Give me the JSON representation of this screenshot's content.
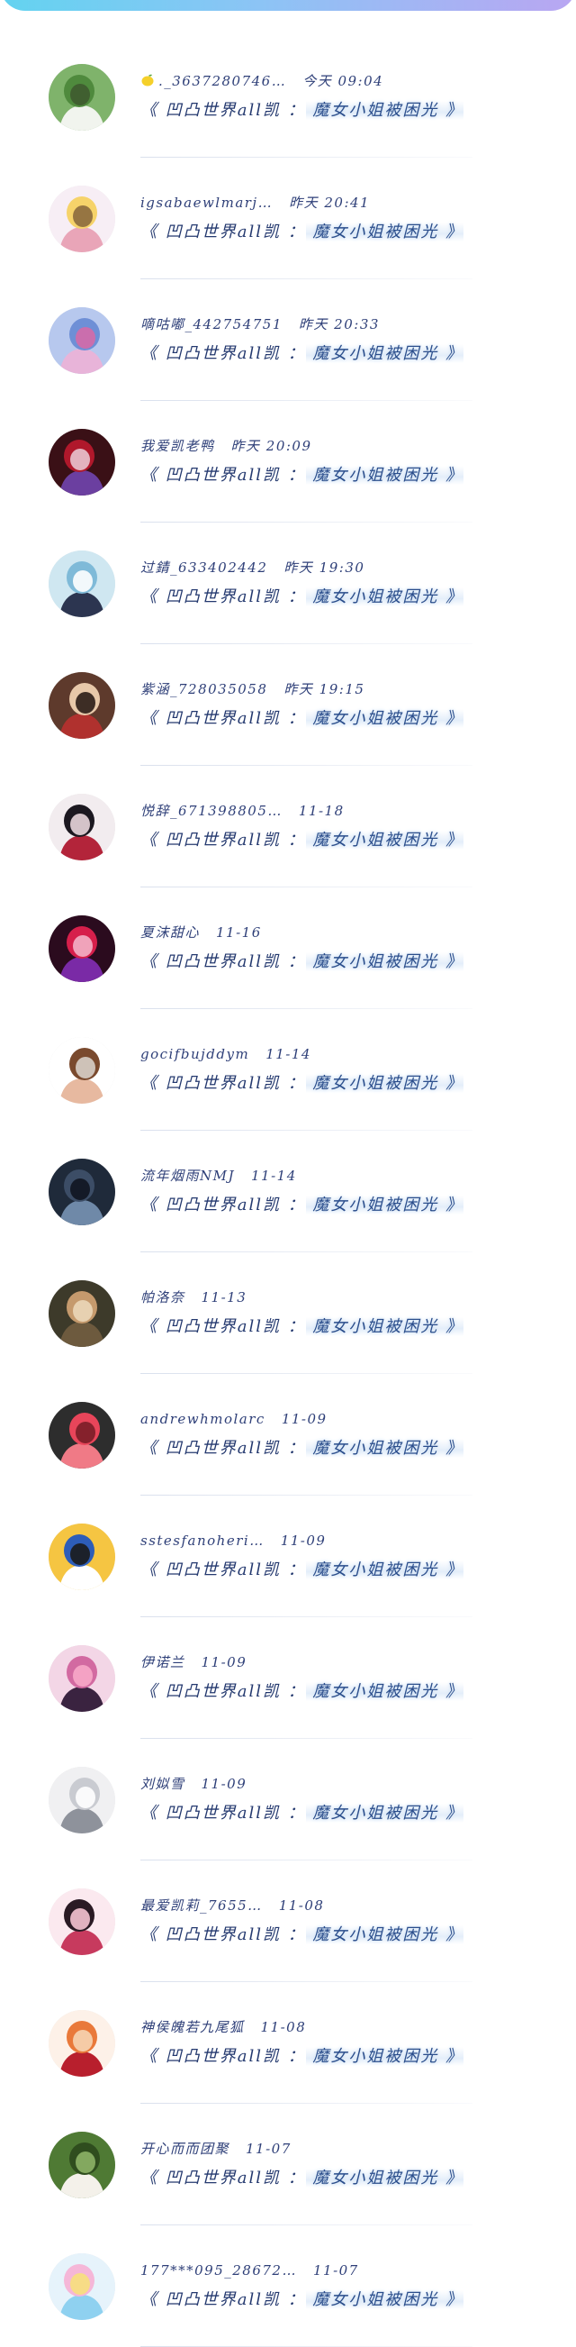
{
  "colors": {
    "accent_gradient_start": "#63d3f0",
    "accent_gradient_end": "#b9a6f2",
    "text": "#2e3f78",
    "highlight_glow": "#cfe0f3"
  },
  "comments": [
    {
      "user": "._3637280746…",
      "time": "今天 09:04",
      "prefix": "《 凹凸世界all凯 ：",
      "highlight": "魔女小姐被困光 》",
      "lemon": true,
      "avatar_palette": [
        "#7fb36b",
        "#4f8a3d",
        "#f1f4ee",
        "#3e5a2f"
      ]
    },
    {
      "user": "igsabaewlmarj…",
      "time": "昨天 20:41",
      "prefix": "《 凹凸世界all凯 ：",
      "highlight": "魔女小姐被困光 》",
      "avatar_palette": [
        "#f7eef5",
        "#f6d36a",
        "#e9a5b8",
        "#8c6a3e"
      ]
    },
    {
      "user": "嘀咕嘟_442754751",
      "time": "昨天 20:33",
      "prefix": "《 凹凸世界all凯 ：",
      "highlight": "魔女小姐被困光 》",
      "avatar_palette": [
        "#b7c8ee",
        "#6e8fd6",
        "#e8b4d9",
        "#d46aa8"
      ]
    },
    {
      "user": "我爱凯老鸭",
      "time": "昨天 20:09",
      "prefix": "《 凹凸世界all凯 ：",
      "highlight": "魔女小姐被困光 》",
      "avatar_palette": [
        "#3a1016",
        "#b0182b",
        "#6b3fa0",
        "#e9c4cf"
      ]
    },
    {
      "user": "过錆_633402442",
      "time": "昨天 19:30",
      "prefix": "《 凹凸世界all凯 ：",
      "highlight": "魔女小姐被困光 》",
      "avatar_palette": [
        "#cfe7f1",
        "#7fbad8",
        "#2c3550",
        "#ffffff"
      ]
    },
    {
      "user": "紫涵_728035058",
      "time": "昨天 19:15",
      "prefix": "《 凹凸世界all凯 ：",
      "highlight": "魔女小姐被困光 》",
      "avatar_palette": [
        "#5e3a2c",
        "#e7c8a9",
        "#b0312e",
        "#2a1c16"
      ]
    },
    {
      "user": "悦辞_671398805…",
      "time": "11-18",
      "prefix": "《 凹凸世界all凯 ：",
      "highlight": "魔女小姐被困光 》",
      "avatar_palette": [
        "#f2ecef",
        "#1c1820",
        "#b3243a",
        "#e9d6dc"
      ]
    },
    {
      "user": "夏沫甜心",
      "time": "11-16",
      "prefix": "《 凹凸世界all凯 ：",
      "highlight": "魔女小姐被困光 》",
      "avatar_palette": [
        "#2b0b1e",
        "#d61f4b",
        "#7a2aa6",
        "#f3b1c6"
      ]
    },
    {
      "user": "gocifbujddym",
      "time": "11-14",
      "prefix": "《 凹凸世界all凯 ：",
      "highlight": "魔女小姐被困光 》",
      "avatar_palette": [
        "#ffffff",
        "#7a4a2e",
        "#e7b9a0",
        "#d7cfc8"
      ]
    },
    {
      "user": "流年烟雨NMJ",
      "time": "11-14",
      "prefix": "《 凹凸世界all凯 ：",
      "highlight": "魔女小姐被困光 》",
      "avatar_palette": [
        "#1f2a3a",
        "#3c4d66",
        "#6f89a8",
        "#0f1520"
      ]
    },
    {
      "user": "帕洛奈",
      "time": "11-13",
      "prefix": "《 凹凸世界all凯 ：",
      "highlight": "魔女小姐被困光 》",
      "avatar_palette": [
        "#3d3a2a",
        "#c59a6d",
        "#6d5a3e",
        "#ead7b8"
      ]
    },
    {
      "user": "andrewhmolarc",
      "time": "11-09",
      "prefix": "《 凹凸世界all凯 ：",
      "highlight": "魔女小姐被困光 》",
      "avatar_palette": [
        "#2d2d2d",
        "#e8455a",
        "#f07a86",
        "#7a1d27"
      ]
    },
    {
      "user": "sstesfanoheri…",
      "time": "11-09",
      "prefix": "《 凹凸世界all凯 ：",
      "highlight": "魔女小姐被困光 》",
      "avatar_palette": [
        "#f5c542",
        "#2d5db8",
        "#ffffff",
        "#1b1b1b"
      ]
    },
    {
      "user": "伊诺兰",
      "time": "11-09",
      "prefix": "《 凹凸世界all凯 ：",
      "highlight": "魔女小姐被困光 》",
      "avatar_palette": [
        "#f3d6e6",
        "#d26aa1",
        "#3a2340",
        "#f7a8c8"
      ]
    },
    {
      "user": "刘姒雪",
      "time": "11-09",
      "prefix": "《 凹凸世界all凯 ：",
      "highlight": "魔女小姐被困光 》",
      "avatar_palette": [
        "#f0f0f2",
        "#c9cbd1",
        "#8e929b",
        "#ffffff"
      ]
    },
    {
      "user": "最爱凯莉_7655…",
      "time": "11-08",
      "prefix": "《 凹凸世界all凯 ：",
      "highlight": "魔女小姐被困光 》",
      "avatar_palette": [
        "#fbe9ef",
        "#2a1a24",
        "#c73a5e",
        "#f5c3d2"
      ]
    },
    {
      "user": "神侯魄若九尾狐",
      "time": "11-08",
      "prefix": "《 凹凸世界all凯 ：",
      "highlight": "魔女小姐被困光 》",
      "avatar_palette": [
        "#fdf1e8",
        "#e9793a",
        "#b81f2d",
        "#f6d4b2"
      ]
    },
    {
      "user": "开心而而团聚",
      "time": "11-07",
      "prefix": "《 凹凸世界all凯 ：",
      "highlight": "魔女小姐被困光 》",
      "avatar_palette": [
        "#4f7a34",
        "#2f4d1e",
        "#f4f1ea",
        "#8db266"
      ]
    },
    {
      "user": "177***095_28672…",
      "time": "11-07",
      "prefix": "《 凹凸世界all凯 ：",
      "highlight": "魔女小姐被困光 》",
      "avatar_palette": [
        "#e6f3fb",
        "#f5b7d8",
        "#8fd1f0",
        "#f7e07d"
      ]
    }
  ]
}
